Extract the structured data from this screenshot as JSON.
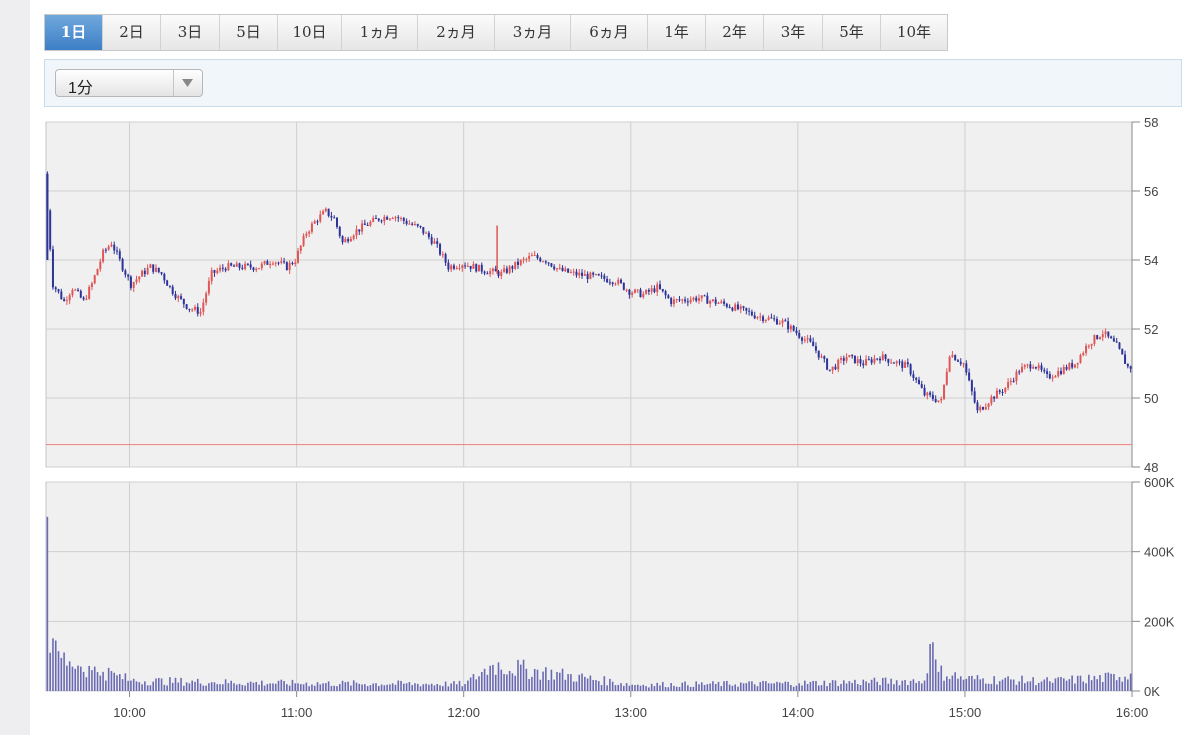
{
  "tabs": [
    "1日",
    "2日",
    "3日",
    "5日",
    "10日",
    "1ヵ月",
    "2ヵ月",
    "3ヵ月",
    "6ヵ月",
    "1年",
    "2年",
    "3年",
    "5年",
    "10年"
  ],
  "active_tab": "1日",
  "interval_select": {
    "value": "1分"
  },
  "colors": {
    "up": "#e05555",
    "down": "#2d3399",
    "volume": "#6a6ab4",
    "reference_line": "#ef8a8a",
    "panel_bg": "#f0f0f0",
    "grid": "#cfcfcf"
  },
  "chart_data": [
    {
      "type": "candlestick",
      "y_axis_ticks": [
        "48",
        "50",
        "52",
        "54",
        "56",
        "58"
      ],
      "ylim": [
        48,
        58
      ],
      "x_axis_ticks": [
        "10:00",
        "11:00",
        "12:00",
        "13:00",
        "14:00",
        "15:00",
        "16:00"
      ],
      "reference_line": 48.65,
      "price_path": [
        [
          "9:30",
          56.5
        ],
        [
          "9:33",
          53.3
        ],
        [
          "9:37",
          52.8
        ],
        [
          "9:40",
          53.2
        ],
        [
          "9:44",
          52.8
        ],
        [
          "9:47",
          53.3
        ],
        [
          "9:51",
          54.2
        ],
        [
          "9:54",
          54.5
        ],
        [
          "9:58",
          53.8
        ],
        [
          "10:01",
          53.3
        ],
        [
          "10:05",
          53.6
        ],
        [
          "10:08",
          53.8
        ],
        [
          "10:12",
          53.6
        ],
        [
          "10:15",
          53.2
        ],
        [
          "10:18",
          52.9
        ],
        [
          "10:22",
          52.6
        ],
        [
          "10:26",
          52.5
        ],
        [
          "10:30",
          53.6
        ],
        [
          "10:35",
          53.8
        ],
        [
          "10:40",
          53.8
        ],
        [
          "10:47",
          53.8
        ],
        [
          "10:52",
          54.0
        ],
        [
          "10:57",
          53.8
        ],
        [
          "11:00",
          54.0
        ],
        [
          "11:04",
          54.8
        ],
        [
          "11:08",
          55.2
        ],
        [
          "11:11",
          55.4
        ],
        [
          "11:14",
          55.2
        ],
        [
          "11:17",
          54.5
        ],
        [
          "11:21",
          54.8
        ],
        [
          "11:25",
          55.0
        ],
        [
          "11:30",
          55.2
        ],
        [
          "11:35",
          55.3
        ],
        [
          "11:40",
          55.1
        ],
        [
          "11:45",
          54.9
        ],
        [
          "11:50",
          54.5
        ],
        [
          "11:55",
          53.8
        ],
        [
          "12:00",
          53.9
        ],
        [
          "12:04",
          53.8
        ],
        [
          "12:08",
          53.7
        ],
        [
          "12:14",
          53.6
        ],
        [
          "12:20",
          53.9
        ],
        [
          "12:25",
          54.1
        ],
        [
          "12:30",
          54.0
        ],
        [
          "12:35",
          53.7
        ],
        [
          "12:40",
          53.6
        ],
        [
          "12:48",
          53.5
        ],
        [
          "12:55",
          53.4
        ],
        [
          "13:00",
          53.1
        ],
        [
          "13:05",
          53.0
        ],
        [
          "13:10",
          53.2
        ],
        [
          "13:15",
          52.8
        ],
        [
          "13:25",
          52.9
        ],
        [
          "13:35",
          52.7
        ],
        [
          "13:45",
          52.4
        ],
        [
          "13:55",
          52.2
        ],
        [
          "14:00",
          51.9
        ],
        [
          "14:06",
          51.5
        ],
        [
          "14:12",
          50.8
        ],
        [
          "14:18",
          51.2
        ],
        [
          "14:24",
          51.0
        ],
        [
          "14:30",
          51.2
        ],
        [
          "14:40",
          50.9
        ],
        [
          "14:46",
          50.1
        ],
        [
          "14:52",
          49.9
        ],
        [
          "14:55",
          51.3
        ],
        [
          "15:00",
          51.0
        ],
        [
          "15:05",
          49.6
        ],
        [
          "15:10",
          50.0
        ],
        [
          "15:15",
          50.3
        ],
        [
          "15:20",
          50.8
        ],
        [
          "15:25",
          51.0
        ],
        [
          "15:30",
          50.6
        ],
        [
          "15:35",
          50.8
        ],
        [
          "15:40",
          51.0
        ],
        [
          "15:45",
          51.6
        ],
        [
          "15:50",
          51.9
        ],
        [
          "15:55",
          51.5
        ],
        [
          "15:59",
          50.9
        ]
      ]
    },
    {
      "type": "bar",
      "y_axis_ticks": [
        "0K",
        "200K",
        "400K",
        "600K"
      ],
      "ylim": [
        0,
        600000
      ],
      "x_axis_ticks": [
        "10:00",
        "11:00",
        "12:00",
        "13:00",
        "14:00",
        "15:00",
        "16:00"
      ],
      "volume_profile": [
        [
          "9:30",
          500000
        ],
        [
          "9:31",
          110000
        ],
        [
          "9:33",
          145000
        ],
        [
          "9:35",
          95000
        ],
        [
          "9:38",
          85000
        ],
        [
          "9:42",
          70000
        ],
        [
          "9:46",
          60000
        ],
        [
          "9:50",
          55000
        ],
        [
          "9:55",
          45000
        ],
        [
          "10:00",
          30000
        ],
        [
          "10:30",
          25000
        ],
        [
          "11:00",
          22000
        ],
        [
          "12:00",
          20000
        ],
        [
          "12:10",
          75000
        ],
        [
          "13:00",
          18000
        ],
        [
          "14:00",
          22000
        ],
        [
          "14:45",
          30000
        ],
        [
          "14:47",
          135000
        ],
        [
          "14:50",
          55000
        ],
        [
          "15:00",
          35000
        ],
        [
          "15:30",
          28000
        ],
        [
          "15:55",
          40000
        ],
        [
          "15:59",
          50000
        ]
      ]
    }
  ]
}
